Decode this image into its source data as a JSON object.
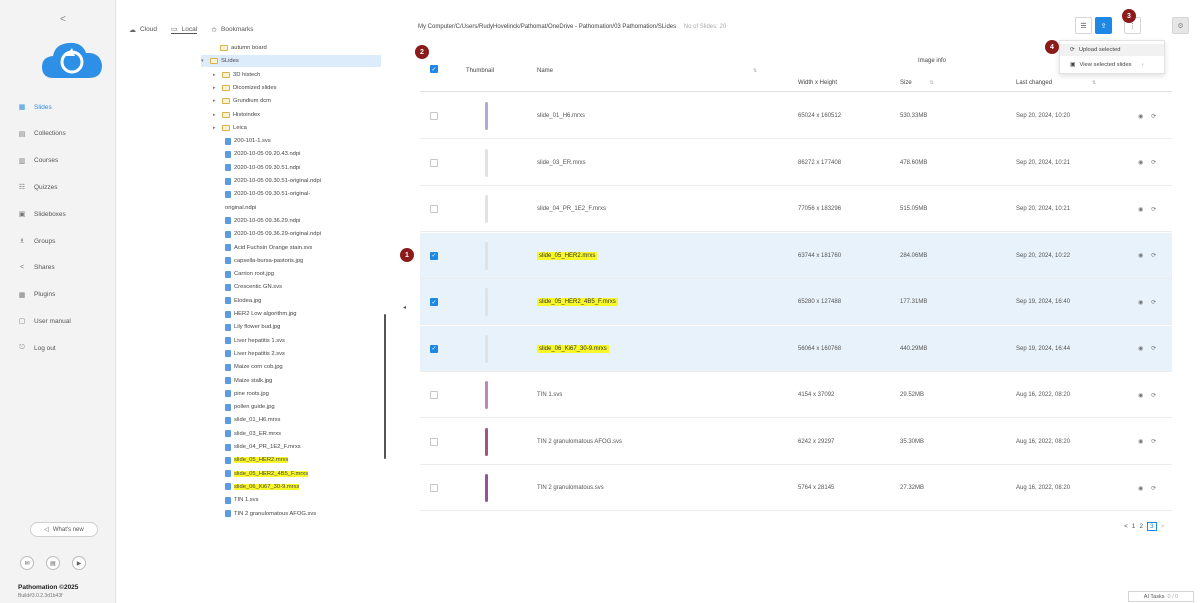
{
  "nav": {
    "collapse": "<",
    "items": [
      {
        "label": "Slides",
        "icon": "slides-icon",
        "glyph": "▦",
        "active": true
      },
      {
        "label": "Collections",
        "icon": "collections-icon",
        "glyph": "▤"
      },
      {
        "label": "Courses",
        "icon": "courses-icon",
        "glyph": "▥"
      },
      {
        "label": "Quizzes",
        "icon": "quizzes-icon",
        "glyph": "☷"
      },
      {
        "label": "Slideboxes",
        "icon": "slideboxes-icon",
        "glyph": "▣"
      },
      {
        "label": "Groups",
        "icon": "groups-icon",
        "glyph": "♗"
      },
      {
        "label": "Shares",
        "icon": "share-icon",
        "glyph": "<"
      },
      {
        "label": "Plugins",
        "icon": "plugins-icon",
        "glyph": "▦"
      },
      {
        "label": "User manual",
        "icon": "manual-icon",
        "glyph": "▢"
      },
      {
        "label": "Log out",
        "icon": "logout-icon",
        "glyph": "⎋"
      }
    ],
    "whats_new": "What's new",
    "brand": "Pathomation ©2025",
    "build": "Build#3.0.2.3d1b43f"
  },
  "tree": {
    "tabs": [
      {
        "label": "Cloud",
        "glyph": "☁"
      },
      {
        "label": "Local",
        "glyph": "▭",
        "active": true
      },
      {
        "label": "Bookmarks",
        "glyph": "✩"
      }
    ],
    "rows": [
      {
        "text": "autumn board",
        "type": "folder",
        "indent": 94,
        "arrow": ""
      },
      {
        "text": "SLides",
        "type": "folder",
        "indent": 84,
        "arrow": "▾",
        "selected": true
      },
      {
        "text": "3D histech",
        "type": "folder",
        "indent": 96,
        "arrow": "▸"
      },
      {
        "text": "Dicomized slides",
        "type": "folder",
        "indent": 96,
        "arrow": "▸"
      },
      {
        "text": "Grundium dcm",
        "type": "folder",
        "indent": 96,
        "arrow": "▸"
      },
      {
        "text": "Histoindex",
        "type": "folder",
        "indent": 96,
        "arrow": "▸"
      },
      {
        "text": "Leica",
        "type": "folder",
        "indent": 96,
        "arrow": "▸"
      },
      {
        "text": "200-101-1.svs",
        "type": "file",
        "indent": 108
      },
      {
        "text": "2020-10-05 09.20.43.ndpi",
        "type": "file",
        "indent": 108
      },
      {
        "text": "2020-10-05 09.30.51.ndpi",
        "type": "file",
        "indent": 108
      },
      {
        "text": "2020-10-05 09.30.51-original.ndpi",
        "type": "file",
        "indent": 108
      },
      {
        "text": "2020-10-05 09.30.51-original-",
        "type": "file",
        "indent": 108
      },
      {
        "text": "original.ndpi",
        "type": "wrap",
        "indent": 108
      },
      {
        "text": "2020-10-05 09.36.29.ndpi",
        "type": "file",
        "indent": 108
      },
      {
        "text": "2020-10-05 09.36.29-original.ndpi",
        "type": "file",
        "indent": 108
      },
      {
        "text": "Acid Fuchsin Orange stain.svs",
        "type": "file",
        "indent": 108
      },
      {
        "text": "capsella-bursa-pastoris.jpg",
        "type": "file",
        "indent": 108
      },
      {
        "text": "Carrion root.jpg",
        "type": "file",
        "indent": 108
      },
      {
        "text": "Crescentic GN.svs",
        "type": "file",
        "indent": 108
      },
      {
        "text": "Elodea.jpg",
        "type": "file",
        "indent": 108
      },
      {
        "text": "HER2 Low algorithm.jpg",
        "type": "file",
        "indent": 108
      },
      {
        "text": "Lily flower bud.jpg",
        "type": "file",
        "indent": 108
      },
      {
        "text": "Liver hepatitis 1.svs",
        "type": "file",
        "indent": 108
      },
      {
        "text": "Liver hepatitis 2.svs",
        "type": "file",
        "indent": 108
      },
      {
        "text": "Maize corn cob.jpg",
        "type": "file",
        "indent": 108
      },
      {
        "text": "Maize stalk.jpg",
        "type": "file",
        "indent": 108
      },
      {
        "text": "pine roots.jpg",
        "type": "file",
        "indent": 108
      },
      {
        "text": "pollen guide.jpg",
        "type": "file",
        "indent": 108
      },
      {
        "text": "slide_01_H6.mrxs",
        "type": "file",
        "indent": 108
      },
      {
        "text": "slide_03_ER.mrxs",
        "type": "file",
        "indent": 108
      },
      {
        "text": "slide_04_PR_1E2_F.mrxs",
        "type": "file",
        "indent": 108
      },
      {
        "text": "slide_05_HER2.mrxs",
        "type": "file",
        "indent": 108,
        "highlight": true
      },
      {
        "text": "slide_05_HER2_4B5_F.mrxs",
        "type": "file",
        "indent": 108,
        "highlight": true
      },
      {
        "text": "slide_06_Ki67_30-9.mrxs",
        "type": "file",
        "indent": 108,
        "highlight": true
      },
      {
        "text": "TIN 1.svs",
        "type": "file",
        "indent": 108
      },
      {
        "text": "TIN 2 granulomatous AFOG.svs",
        "type": "file",
        "indent": 108
      }
    ]
  },
  "main": {
    "breadcrumb": "My Computer/C/Users/RudyHovelinck/Pathomat/OneDrive - Pathomation/03 Pathomation/SLides",
    "slide_count": "No of Slides: 20",
    "menu": {
      "upload": "Upload selected",
      "view": "View selected slides",
      "upload_glyph": "⟳",
      "view_glyph": "▣",
      "more_glyph": "›"
    },
    "markers": [
      "1",
      "2",
      "3",
      "4"
    ],
    "columns": {
      "thumbnail": "Thumbnail",
      "name": "Name",
      "image_info": "Image info",
      "width_height": "Width x Height",
      "size": "Size",
      "last_changed": "Last changed",
      "sort_glyph": "⇅"
    },
    "rows": [
      {
        "name": "slide_01_H6.mrxs",
        "dims": "65024 x 160512",
        "size": "530.33MB",
        "changed": "Sep 20, 2024, 10:20",
        "selected": false,
        "thumb": "#b9a3d9"
      },
      {
        "name": "slide_03_ER.mrxs",
        "dims": "86272 x 177408",
        "size": "478.60MB",
        "changed": "Sep 20, 2024, 10:21",
        "selected": false,
        "thumb": "#e2e2e2"
      },
      {
        "name": "slide_04_PR_1E2_F.mrxs",
        "dims": "77056 x 183296",
        "size": "515.05MB",
        "changed": "Sep 20, 2024, 10:21",
        "selected": false,
        "thumb": "#e2e2e2"
      },
      {
        "name": "slide_05_HER2.mrxs",
        "dims": "63744 x 181760",
        "size": "284.06MB",
        "changed": "Sep 20, 2024, 10:22",
        "selected": true,
        "highlight": true,
        "thumb": "#e2e2e2"
      },
      {
        "name": "slide_05_HER2_4B5_F.mrxs",
        "dims": "65280 x 127488",
        "size": "177.31MB",
        "changed": "Sep 19, 2024, 16:40",
        "selected": true,
        "highlight": true,
        "thumb": "#e2e2e2"
      },
      {
        "name": "slide_06_Ki67_30-9.mrxs",
        "dims": "56064 x 160768",
        "size": "440.29MB",
        "changed": "Sep 19, 2024, 16:44",
        "selected": true,
        "highlight": true,
        "thumb": "#e2e2e2"
      },
      {
        "name": "TIN 1.svs",
        "dims": "4154 x 37092",
        "size": "29.52MB",
        "changed": "Aug 16, 2022, 08:20",
        "selected": false,
        "thumb": "#b98ab8"
      },
      {
        "name": "TIN 2 granulomatous AFOG.svs",
        "dims": "6242 x 29297",
        "size": "35.30MB",
        "changed": "Aug 16, 2022, 08:20",
        "selected": false,
        "thumb": "#a0567f"
      },
      {
        "name": "TIN 2 granulomatous.svs",
        "dims": "5764 x 28145",
        "size": "27.32MB",
        "changed": "Aug 16, 2022, 08:20",
        "selected": false,
        "thumb": "#9c4fa1"
      }
    ],
    "row_actions": {
      "view_glyph": "◉",
      "upload_glyph": "⟳"
    },
    "pager": {
      "prev": "<",
      "pages": [
        "1",
        "2",
        "3"
      ],
      "current": "3",
      "next": ">"
    },
    "tasks": {
      "label": "AI Tasks",
      "count": "0 / 0"
    }
  },
  "colors": {
    "accent": "#1e88e5",
    "selected_row": "#e7f2fb",
    "highlight": "#f7f72a",
    "marker": "#8b1a1a"
  }
}
